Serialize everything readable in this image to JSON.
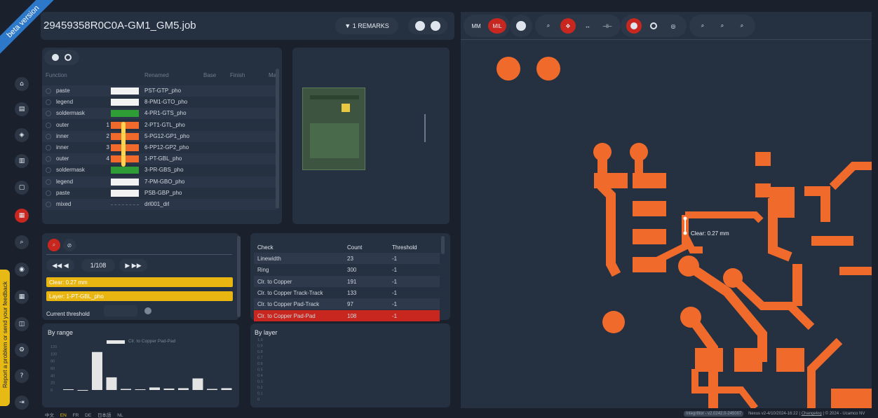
{
  "app": {
    "beta": "beta version",
    "title": "29459358R0C0A-GM1_GM5.job",
    "feedback": "Report a problem or send your feedback"
  },
  "header": {
    "remarks": "▼ 1 REMARKS"
  },
  "layers": {
    "headers": [
      "Function",
      "Renamed",
      "Base",
      "Finish",
      "Ma"
    ],
    "rows": [
      {
        "fn": "paste",
        "num": "",
        "color": "#f2f2f2",
        "name": "PST-GTP_pho"
      },
      {
        "fn": "legend",
        "num": "",
        "color": "#f2f2f2",
        "name": "8-PM1-GTO_pho"
      },
      {
        "fn": "soldermask",
        "num": "",
        "color": "#2e9d35",
        "name": "4-PR1-GTS_pho"
      },
      {
        "fn": "outer",
        "num": "1",
        "color": "#f06b2b",
        "name": "2-PT1-GTL_pho"
      },
      {
        "fn": "inner",
        "num": "2",
        "color": "#f06b2b",
        "name": "5-PG12-GP1_pho"
      },
      {
        "fn": "inner",
        "num": "3",
        "color": "#f06b2b",
        "name": "6-PP12-GP2_pho"
      },
      {
        "fn": "outer",
        "num": "4",
        "color": "#f06b2b",
        "name": "1-PT-GBL_pho"
      },
      {
        "fn": "soldermask",
        "num": "",
        "color": "#2e9d35",
        "name": "3-PR-GBS_pho"
      },
      {
        "fn": "legend",
        "num": "",
        "color": "#f2f2f2",
        "name": "7-PM-GBO_pho"
      },
      {
        "fn": "paste",
        "num": "",
        "color": "#f2f2f2",
        "name": "PSB-GBP_pho"
      },
      {
        "fn": "mixed",
        "num": "",
        "color": "",
        "name": "drl001_drl"
      }
    ]
  },
  "checks": {
    "page": "1/108",
    "clear": "Clear: 0.27 mm",
    "layer": "Layer: 1-PT-GBL_pho",
    "threshold_label": "Current threshold"
  },
  "table": {
    "headers": [
      "Check",
      "Count",
      "Threshold"
    ],
    "rows": [
      {
        "check": "Linewidth",
        "count": "23",
        "th": "-1"
      },
      {
        "check": "Ring",
        "count": "300",
        "th": "-1"
      },
      {
        "check": "Clr. to Copper",
        "count": "191",
        "th": "-1"
      },
      {
        "check": "Clr. to Copper Track-Track",
        "count": "133",
        "th": "-1"
      },
      {
        "check": "Clr. to Copper Pad-Track",
        "count": "97",
        "th": "-1"
      },
      {
        "check": "Clr. to Copper Pad-Pad",
        "count": "108",
        "th": "-1"
      }
    ]
  },
  "hist": {
    "title": "By range",
    "legend": "Clr. to Copper Pad-Pad"
  },
  "bylayer": {
    "title": "By layer"
  },
  "chart_data": [
    {
      "type": "bar",
      "title": "By range",
      "ylim": [
        0,
        120
      ],
      "yticks": [
        "0",
        "20",
        "40",
        "60",
        "80",
        "100",
        "120"
      ],
      "series": [
        {
          "name": "Clr. to Copper Pad-Pad",
          "values": [
            2,
            0,
            105,
            35,
            3,
            2,
            7,
            4,
            5,
            32,
            3,
            5
          ]
        }
      ]
    },
    {
      "type": "bar",
      "title": "By layer",
      "yticks": [
        "0",
        "0.1",
        "0.2",
        "0.3",
        "0.4",
        "0.5",
        "0.6",
        "0.7",
        "0.8",
        "0.9",
        "1.0"
      ]
    }
  ],
  "view": {
    "mm": "MM",
    "mil": "MIL",
    "measure": "Clear: 0.27 mm"
  },
  "langs": [
    "中文",
    "EN",
    "FR",
    "DE",
    "日本語",
    "NL"
  ],
  "footer": {
    "version": "Integr8tor - v2.0242.0-245007",
    "nexus": "Nexus v2-4/10/2024-16:22",
    "changelog": "Changelog",
    "copy": "© 2024 - Ucamco NV"
  },
  "colors": {
    "accent": "#c8271f",
    "copper": "#f06b2b",
    "panel": "#253040"
  }
}
